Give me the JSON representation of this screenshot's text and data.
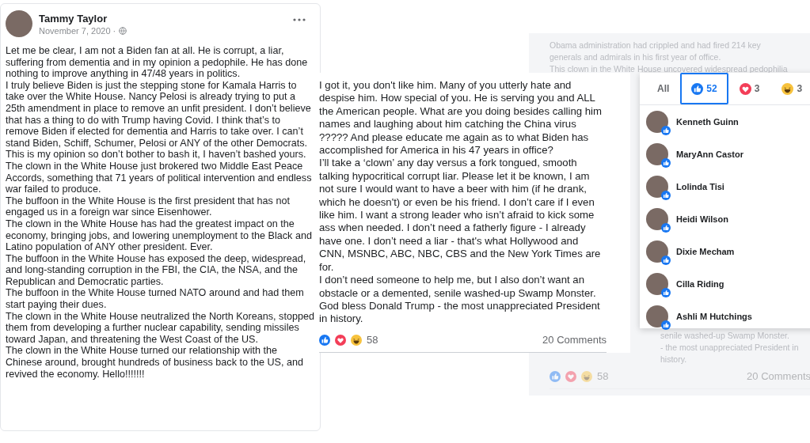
{
  "post": {
    "author": "Tammy Taylor",
    "date": "November 7, 2020 ·",
    "paragraphs": [
      "Let me be clear, I am not a Biden fan at all. He is corrupt, a liar, suffering from dementia and in my opinion a pedophile. He has done nothing to improve anything in 47/48 years in politics.",
      "I truly believe Biden is just the stepping stone for Kamala Harris to take over the White House. Nancy Pelosi is already trying to put a 25th amendment in place to remove an unfit president. I don’t believe that has a thing to do with Trump having Covid. I think that’s to remove Biden if elected for dementia and Harris to take over. I can’t stand Biden, Schiff, Schumer, Pelosi or ANY of the other Democrats.",
      "This is my opinion so don’t bother to bash it, I haven’t bashed yours.",
      "The clown in the White House just brokered two Middle East Peace Accords, something that 71 years of political intervention and endless war failed to produce.",
      "The buffoon in the White House is the first president that has not engaged us in a foreign war since Eisenhower.",
      "The clown in the White House has had the greatest impact on the economy, bringing jobs, and lowering unemployment to the Black and Latino population of ANY other president. Ever.",
      "The buffoon in the White House has exposed the deep, widespread, and long-standing corruption in the FBI, the CIA, the NSA, and the Republican and Democratic parties.",
      "The buffoon in the White House turned NATO around and had them start paying their dues.",
      "The clown in the White House neutralized the North Koreans, stopped them from developing a further nuclear capability, sending missiles toward Japan, and threatening the West Coast of the US.",
      "The clown in the White House turned our relationship with the Chinese around, brought hundreds of business back to the US, and revived the economy. Hello!!!!!!!"
    ]
  },
  "background_post": {
    "top_lines": [
      "Obama administration had crippled and had fired 214 key",
      "generals and admirals in his first year of office.",
      "This clown in the White House uncovered widespread pedophilia"
    ],
    "bottom_lines": [
      "senile washed-up Swamp Monster.",
      "- the most unappreciated President in",
      "history."
    ],
    "reaction_count": "58",
    "comments": "20 Comments"
  },
  "comment": {
    "paragraphs": [
      "I got it, you don't like him. Many of you utterly hate and despise him. How special of you. He is serving you and ALL the American people. What are you doing besides calling him names and laughing about him catching the China virus ????? And please educate me again as to what Biden has accomplished for America in his 47 years in office?",
      "I’ll take a ‘clown’ any day versus a fork tongued, smooth talking hypocritical corrupt liar. Please let it be known, I am not sure I would want to have a beer with him (if he drank, which he doesn't) or even be his friend. I don’t care if I even like him. I want a strong leader who isn’t afraid to kick some ass when needed. I don’t need a fatherly figure - I already have one. I don’t need a liar - that's what Hollywood and CNN, MSNBC, ABC, NBC, CBS and the New York Times are for.",
      "I don’t need someone to help me, but I also don’t want an obstacle or a demented, senile washed-up Swamp Monster.",
      "God bless Donald Trump - the most unappreciated President in history."
    ],
    "reaction_count": "58",
    "comments": "20 Comments"
  },
  "reactions_dialog": {
    "tabs": [
      {
        "kind": "all",
        "label": "All",
        "selected": false
      },
      {
        "kind": "like",
        "label": "52",
        "selected": true
      },
      {
        "kind": "love",
        "label": "3",
        "selected": false
      },
      {
        "kind": "haha",
        "label": "3",
        "selected": false
      }
    ],
    "people": [
      {
        "name": "Kenneth Guinn"
      },
      {
        "name": "MaryAnn Castor"
      },
      {
        "name": "Lolinda Tisi"
      },
      {
        "name": "Heidi Wilson"
      },
      {
        "name": "Dixie Mecham"
      },
      {
        "name": "Cilla Riding"
      },
      {
        "name": "Ashli M Hutchings"
      }
    ]
  }
}
